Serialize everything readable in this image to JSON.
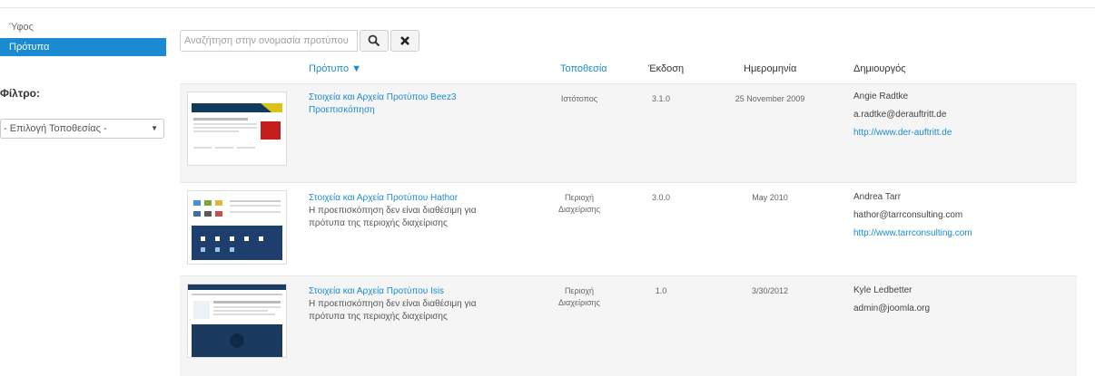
{
  "sidebar": {
    "items": [
      {
        "label": "Ύφος"
      },
      {
        "label": "Πρότυπα"
      }
    ],
    "filter_label": "Φίλτρο:",
    "filter_select": "- Επιλογή Τοποθεσίας -"
  },
  "search": {
    "placeholder": "Αναζήτηση στην ονομασία προτύπου"
  },
  "table": {
    "headers": {
      "template": "Πρότυπο ▼",
      "location": "Τοποθεσία",
      "version": "Έκδοση",
      "date": "Ημερομηνία",
      "author": "Δημιουργός"
    },
    "rows": [
      {
        "title_line1": "Στοιχεία και Αρχεία Προτύπου Beez3",
        "title_line2": "Προεπισκόπηση",
        "desc_line1": "",
        "desc_line2": "",
        "location_line1": "Ιστότοπος",
        "location_line2": "",
        "version": "3.1.0",
        "date": "25 November 2009",
        "author_name": "Angie Radtke",
        "author_email": "a.radtke@derauftritt.de",
        "author_url": "http://www.der-auftritt.de"
      },
      {
        "title_line1": "Στοιχεία και Αρχεία Προτύπου Hathor",
        "title_line2": "",
        "desc_line1": "Η προεπισκόπηση δεν είναι διαθέσιμη για",
        "desc_line2": "πρότυπα της περιοχής διαχείρισης",
        "location_line1": "Περιοχή",
        "location_line2": "Διαχείρισης",
        "version": "3.0.0",
        "date": "May 2010",
        "author_name": "Andrea Tarr",
        "author_email": "hathor@tarrconsulting.com",
        "author_url": "http://www.tarrconsulting.com"
      },
      {
        "title_line1": "Στοιχεία και Αρχεία Προτύπου Isis",
        "title_line2": "",
        "desc_line1": "Η προεπισκόπηση δεν είναι διαθέσιμη για",
        "desc_line2": "πρότυπα της περιοχής διαχείρισης",
        "location_line1": "Περιοχή",
        "location_line2": "Διαχείρισης",
        "version": "1.0",
        "date": "3/30/2012",
        "author_name": "Kyle Ledbetter",
        "author_email": "admin@joomla.org",
        "author_url": ""
      }
    ]
  },
  "colors": {
    "accent": "#1a8bd3"
  },
  "icons": {
    "search_button": "search-icon",
    "clear_button": "close-icon"
  }
}
